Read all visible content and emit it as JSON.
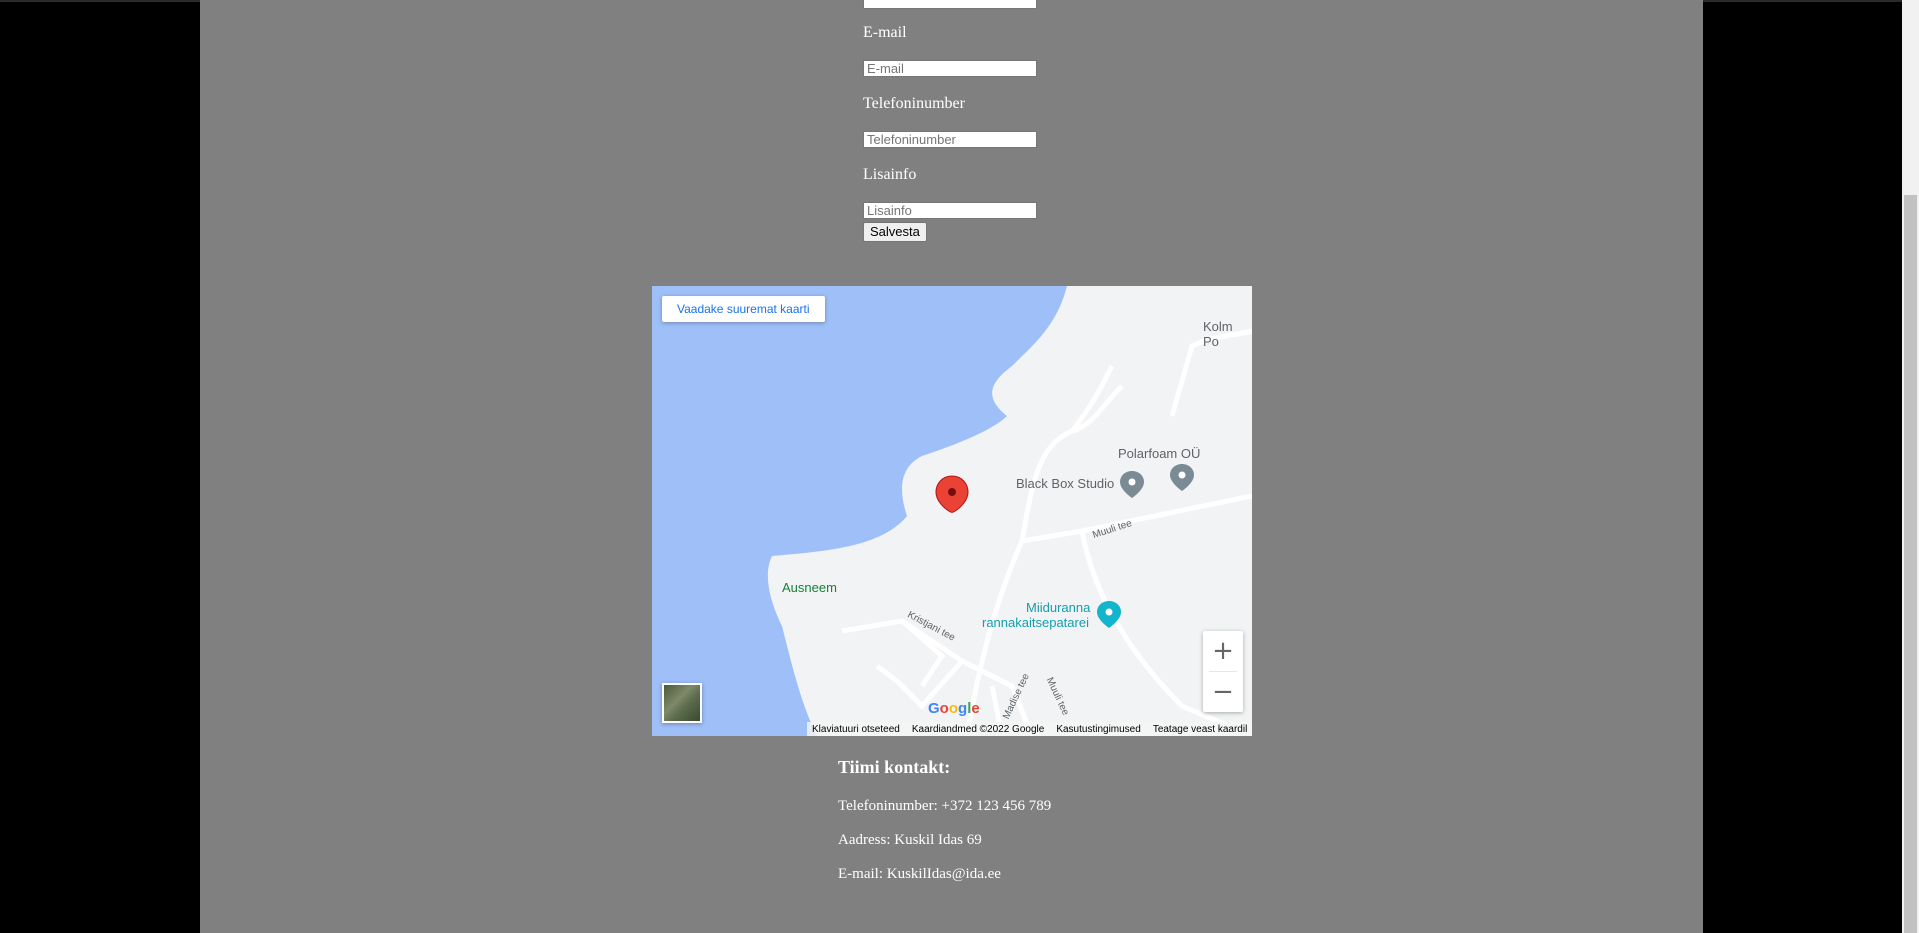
{
  "form": {
    "email_label": "E-mail",
    "email_placeholder": "E-mail",
    "phone_label": "Telefoninumber",
    "phone_placeholder": "Telefoninumber",
    "info_label": "Lisainfo",
    "info_placeholder": "Lisainfo",
    "save_label": "Salvesta"
  },
  "map": {
    "larger_map_link": "Vaadake suuremat kaarti",
    "places": {
      "kolm": "Kolm Po",
      "polarfoam": "Polarfoam OÜ",
      "blackbox": "Black Box Studio",
      "ausneem": "Ausneem",
      "miiduranna1": "Miiduranna",
      "miiduranna2": "rannakaitsepatarei"
    },
    "roads": {
      "muuli1": "Muuli tee",
      "kristjani": "Kristjani tee",
      "madise": "Madise tee",
      "muuli2": "Muuli tee"
    },
    "zoom_in": "+",
    "zoom_out": "−",
    "footer": {
      "shortcuts": "Klaviatuuri otseteed",
      "data": "Kaardiandmed ©2022 Google",
      "terms": "Kasutustingimused",
      "report": "Teatage veast kaardil"
    },
    "logo": "Google",
    "colors": {
      "water": "#9ebff8",
      "land": "#f1f3f4",
      "pin": "#ea4335",
      "park": "#188038",
      "poi_teal": "#12b5cb"
    }
  },
  "contact": {
    "title": "Tiimi kontakt:",
    "phone": "Telefoninumber: +372 123 456 789",
    "address": "Aadress: Kuskil Idas 69",
    "email": "E-mail: KuskilIdas@ida.ee"
  }
}
